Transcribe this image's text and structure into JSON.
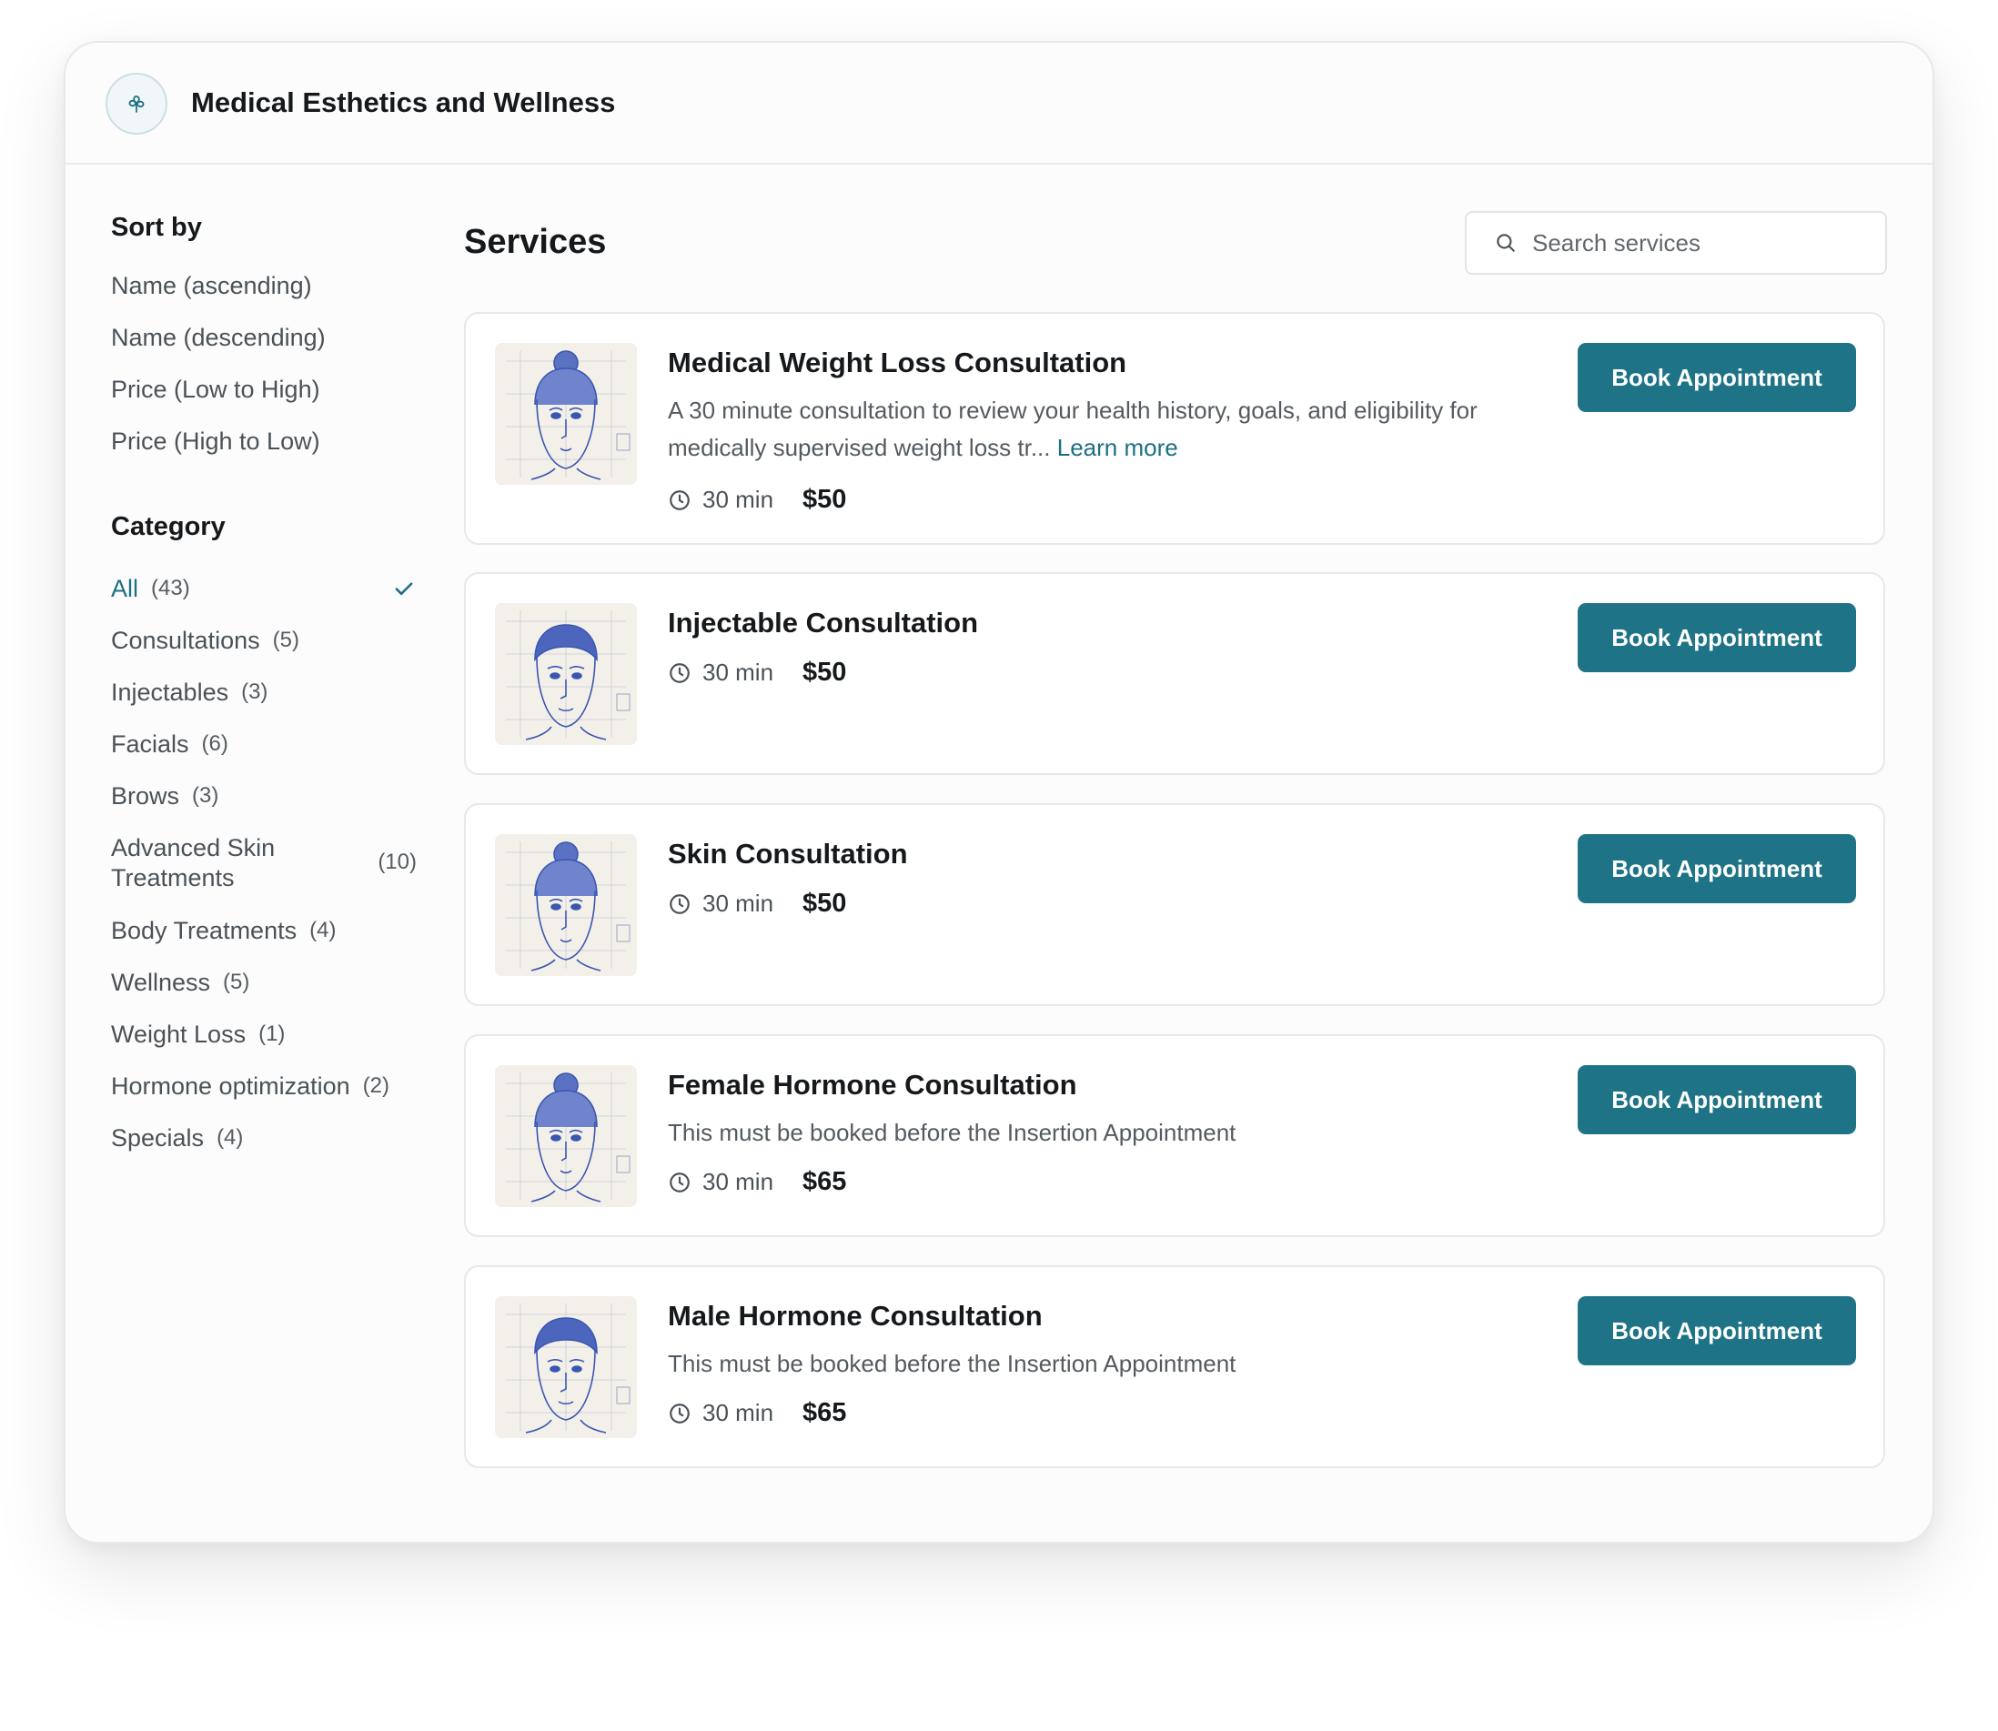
{
  "header": {
    "title": "Medical Esthetics and Wellness",
    "logo_icon": "leaf-clover-icon"
  },
  "sidebar": {
    "sort_heading": "Sort by",
    "sort_options": [
      {
        "label": "Name (ascending)"
      },
      {
        "label": "Name (descending)"
      },
      {
        "label": "Price (Low to High)"
      },
      {
        "label": "Price (High to Low)"
      }
    ],
    "category_heading": "Category",
    "categories": [
      {
        "label": "All",
        "count": "(43)",
        "selected": true
      },
      {
        "label": "Consultations",
        "count": "(5)"
      },
      {
        "label": "Injectables",
        "count": "(3)"
      },
      {
        "label": "Facials",
        "count": "(6)"
      },
      {
        "label": "Brows",
        "count": "(3)"
      },
      {
        "label": "Advanced Skin Treatments",
        "count": "(10)"
      },
      {
        "label": "Body Treatments",
        "count": "(4)"
      },
      {
        "label": "Wellness",
        "count": "(5)"
      },
      {
        "label": "Weight Loss",
        "count": "(1)"
      },
      {
        "label": "Hormone optimization",
        "count": "(2)"
      },
      {
        "label": "Specials",
        "count": "(4)"
      }
    ]
  },
  "main": {
    "title": "Services",
    "search": {
      "placeholder": "Search services",
      "value": ""
    },
    "services": [
      {
        "title": "Medical Weight Loss Consultation",
        "description": "A 30 minute consultation to review your health history, goals, and eligibility for medically supervised weight loss tr...",
        "learn_more": "Learn more",
        "duration": "30 min",
        "price": "$50",
        "button": "Book Appointment",
        "image": "female-face-sketch"
      },
      {
        "title": "Injectable Consultation",
        "duration": "30 min",
        "price": "$50",
        "button": "Book Appointment",
        "image": "male-face-sketch"
      },
      {
        "title": "Skin Consultation",
        "duration": "30 min",
        "price": "$50",
        "button": "Book Appointment",
        "image": "female-face-sketch"
      },
      {
        "title": "Female Hormone Consultation",
        "description": "This must be booked before the Insertion Appointment",
        "duration": "30 min",
        "price": "$65",
        "button": "Book Appointment",
        "image": "female-face-sketch"
      },
      {
        "title": "Male Hormone Consultation",
        "description": "This must be booked before the Insertion Appointment",
        "duration": "30 min",
        "price": "$65",
        "button": "Book Appointment",
        "image": "male-face-sketch"
      }
    ]
  },
  "colors": {
    "accent": "#1e7386",
    "link": "#1d6f84",
    "sketch": "#3a57b0"
  }
}
